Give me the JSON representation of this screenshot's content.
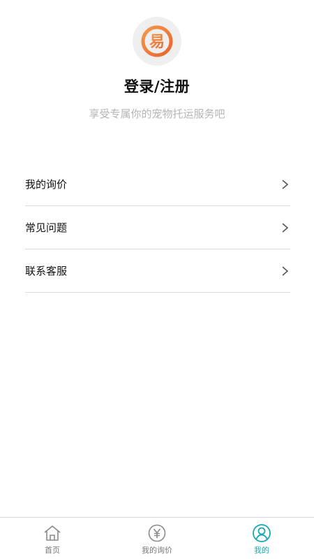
{
  "profile": {
    "avatar_glyph": "易",
    "title": "登录/注册",
    "subtitle": "享受专属你的宠物托运服务吧"
  },
  "menu": {
    "items": [
      {
        "label": "我的询价"
      },
      {
        "label": "常见问题"
      },
      {
        "label": "联系客服"
      }
    ],
    "chevron": "chevron-right-icon"
  },
  "tabbar": {
    "tabs": [
      {
        "label": "首页",
        "icon": "home-icon",
        "active": false
      },
      {
        "label": "我的询价",
        "icon": "yuan-circle-icon",
        "active": false
      },
      {
        "label": "我的",
        "icon": "user-circle-icon",
        "active": true
      }
    ]
  },
  "colors": {
    "accent": "#19a7b3",
    "logo_orange": "#f07a3c",
    "muted_text": "#b4b4b4",
    "divider": "#dcdcdc"
  }
}
